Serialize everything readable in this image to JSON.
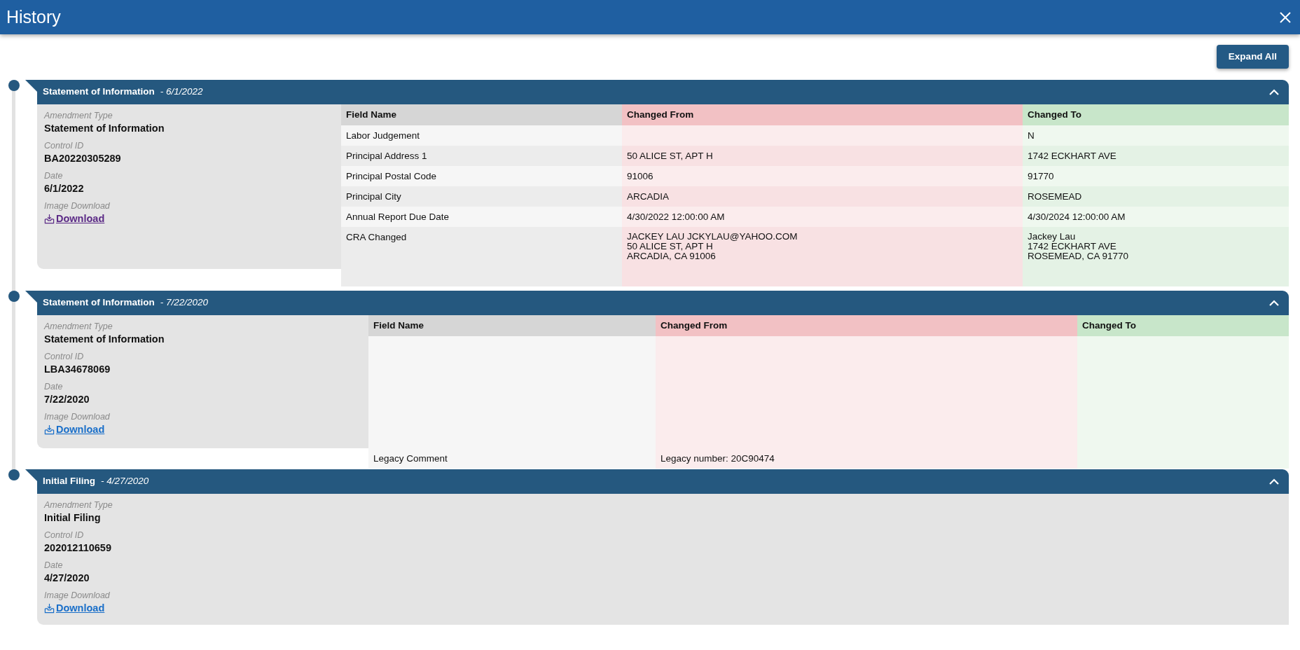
{
  "window": {
    "title": "History"
  },
  "toolbar": {
    "expand_all": "Expand All"
  },
  "entries": [
    {
      "title": "Statement of Information",
      "date": "- 6/1/2022",
      "expanded": true,
      "details": [
        {
          "label": "Amendment Type",
          "value": "Statement of Information"
        },
        {
          "label": "Control ID",
          "value": "BA20220305289"
        },
        {
          "label": "Date",
          "value": "6/1/2022"
        }
      ],
      "download": {
        "label": "Image Download",
        "link": "Download",
        "visited": true
      },
      "changes": {
        "columns": [
          "Field Name",
          "Changed From",
          "Changed To"
        ],
        "rows": [
          {
            "field": "Labor Judgement",
            "to": "N"
          },
          {
            "field": "Principal Address 1",
            "from": "50 ALICE ST, APT H",
            "to": "1742 ECKHART AVE"
          },
          {
            "field": "Principal Postal Code",
            "from": "91006",
            "to": "91770"
          },
          {
            "field": "Principal City",
            "from": "ARCADIA",
            "to": "ROSEMEAD"
          },
          {
            "field": "Annual Report Due Date",
            "from": "4/30/2022 12:00:00 AM",
            "to": "4/30/2024 12:00:00 AM"
          },
          {
            "field": "CRA Changed",
            "from": "JACKEY LAU JCKYLAU@YAHOO.COM\n50 ALICE ST, APT H\nARCADIA, CA 91006",
            "to": "Jackey Lau\n1742 ECKHART AVE\nROSEMEAD, CA 91770"
          }
        ]
      }
    },
    {
      "title": "Statement of Information",
      "date": "- 7/22/2020",
      "expanded": true,
      "details": [
        {
          "label": "Amendment Type",
          "value": "Statement of Information"
        },
        {
          "label": "Control ID",
          "value": "LBA34678069"
        },
        {
          "label": "Date",
          "value": "7/22/2020"
        }
      ],
      "download": {
        "label": "Image Download",
        "link": "Download",
        "visited": false
      },
      "changes": {
        "columns": [
          "Field Name",
          "Changed From",
          "Changed To"
        ],
        "rows": [
          {
            "field": "Legacy Comment",
            "from": "Legacy number: 20C90474"
          }
        ]
      }
    },
    {
      "title": "Initial Filing",
      "date": "- 4/27/2020",
      "expanded": true,
      "details": [
        {
          "label": "Amendment Type",
          "value": "Initial Filing"
        },
        {
          "label": "Control ID",
          "value": "202012110659"
        },
        {
          "label": "Date",
          "value": "4/27/2020"
        }
      ],
      "download": {
        "label": "Image Download",
        "link": "Download",
        "visited": false
      }
    }
  ]
}
